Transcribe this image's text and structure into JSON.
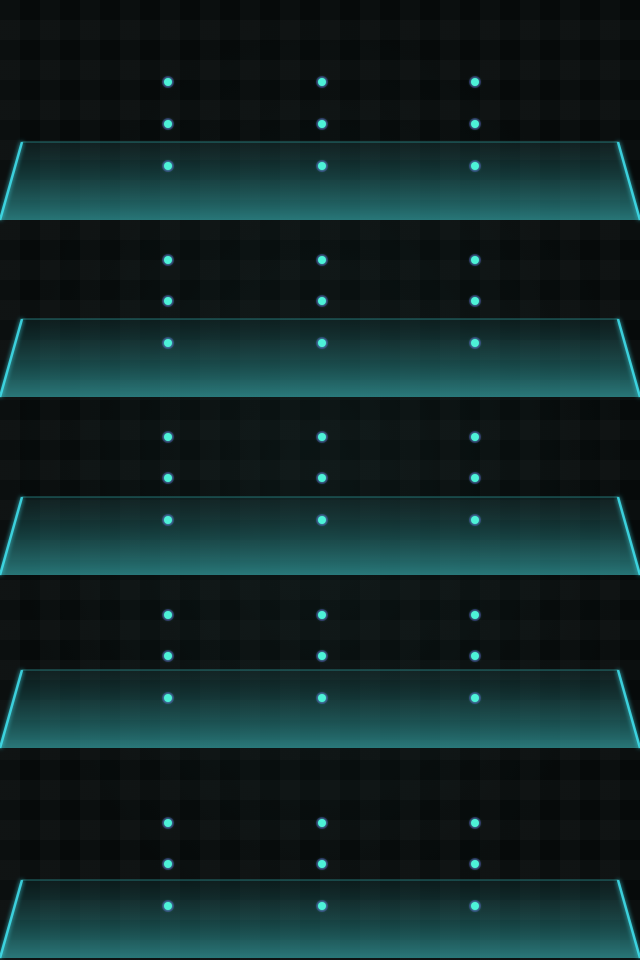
{
  "theme": {
    "background": "#060a0a",
    "shelf_glow": "#3fe3f0",
    "shelf_fill": "#2a8f90",
    "dot_color": "#4ef2d8",
    "dot_halo": "#7a3cff"
  },
  "shelves": {
    "count": 5,
    "dot_columns": 3,
    "dots_per_column": 3
  }
}
